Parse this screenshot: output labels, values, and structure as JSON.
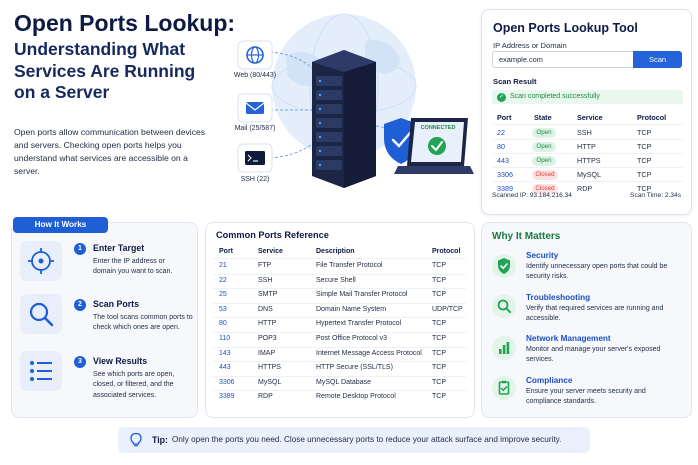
{
  "hero": {
    "title": "Open Ports Lookup:",
    "subtitle_lines": [
      "Understanding What",
      "Services Are Running",
      "on a Server"
    ],
    "description": "Open ports allow communication between devices and servers. Checking open ports helps you understand what services are accessible on a server."
  },
  "illustration": {
    "services": [
      {
        "icon": "globe-icon",
        "label": "Web (80/443)"
      },
      {
        "icon": "mail-icon",
        "label": "Mail (25/587)"
      },
      {
        "icon": "terminal-icon",
        "label": "SSH (22)"
      }
    ],
    "laptop_status": "CONNECTED"
  },
  "tool": {
    "title": "Open Ports Lookup Tool",
    "ip_label": "IP Address or Domain",
    "input_value": "example.com",
    "scan_button": "Scan",
    "result_label": "Scan Result",
    "success_message": "Scan completed successfully",
    "columns": [
      "Port",
      "State",
      "Service",
      "Protocol"
    ],
    "rows": [
      {
        "port": "22",
        "state": "Open",
        "service": "SSH",
        "protocol": "TCP"
      },
      {
        "port": "80",
        "state": "Open",
        "service": "HTTP",
        "protocol": "TCP"
      },
      {
        "port": "443",
        "state": "Open",
        "service": "HTTPS",
        "protocol": "TCP"
      },
      {
        "port": "3306",
        "state": "Closed",
        "service": "MySQL",
        "protocol": "TCP"
      },
      {
        "port": "3389",
        "state": "Closed",
        "service": "RDP",
        "protocol": "TCP"
      }
    ],
    "scanned_ip": "Scanned IP: 93.184.216.34",
    "scan_time": "Scan Time: 2.34s"
  },
  "how_it_works": {
    "title": "How It Works",
    "steps": [
      {
        "num": "1",
        "icon": "target-icon",
        "title": "Enter Target",
        "desc": "Enter the IP address or domain you want to scan."
      },
      {
        "num": "2",
        "icon": "search-icon",
        "title": "Scan Ports",
        "desc": "The tool scans common ports to check which ones are open."
      },
      {
        "num": "3",
        "icon": "list-icon",
        "title": "View Results",
        "desc": "See which ports are open, closed, or filtered, and the associated services."
      }
    ]
  },
  "common_ports": {
    "title": "Common Ports Reference",
    "columns": [
      "Port",
      "Service",
      "Description",
      "Protocol"
    ],
    "rows": [
      {
        "port": "21",
        "service": "FTP",
        "description": "File Transfer Protocol",
        "protocol": "TCP"
      },
      {
        "port": "22",
        "service": "SSH",
        "description": "Secure Shell",
        "protocol": "TCP"
      },
      {
        "port": "25",
        "service": "SMTP",
        "description": "Simple Mail Transfer Protocol",
        "protocol": "TCP"
      },
      {
        "port": "53",
        "service": "DNS",
        "description": "Domain Name System",
        "protocol": "UDP/TCP"
      },
      {
        "port": "80",
        "service": "HTTP",
        "description": "Hypertext Transfer Protocol",
        "protocol": "TCP"
      },
      {
        "port": "110",
        "service": "POP3",
        "description": "Post Office Protocol v3",
        "protocol": "TCP"
      },
      {
        "port": "143",
        "service": "IMAP",
        "description": "Internet Message Access Protocol",
        "protocol": "TCP"
      },
      {
        "port": "443",
        "service": "HTTPS",
        "description": "HTTP Secure (SSL/TLS)",
        "protocol": "TCP"
      },
      {
        "port": "3306",
        "service": "MySQL",
        "description": "MySQL Database",
        "protocol": "TCP"
      },
      {
        "port": "3389",
        "service": "RDP",
        "description": "Remote Desktop Protocol",
        "protocol": "TCP"
      }
    ]
  },
  "why_it_matters": {
    "title": "Why It Matters",
    "items": [
      {
        "icon": "shield-check-icon",
        "title": "Security",
        "desc": "Identify unnecessary open ports that could be security risks."
      },
      {
        "icon": "magnifier-icon",
        "title": "Troubleshooting",
        "desc": "Verify that required services are running and accessible."
      },
      {
        "icon": "bar-chart-icon",
        "title": "Network Management",
        "desc": "Monitor and manage your server's exposed services."
      },
      {
        "icon": "clipboard-check-icon",
        "title": "Compliance",
        "desc": "Ensure your server meets security and compliance standards."
      }
    ]
  },
  "tip": {
    "label": "Tip:",
    "text": "Only open the ports you need. Close unnecessary ports to reduce your attack surface and improve security."
  },
  "colors": {
    "accent": "#1f5fd6",
    "navy": "#0c1a44",
    "success": "#22a355",
    "danger": "#d23b3b"
  }
}
